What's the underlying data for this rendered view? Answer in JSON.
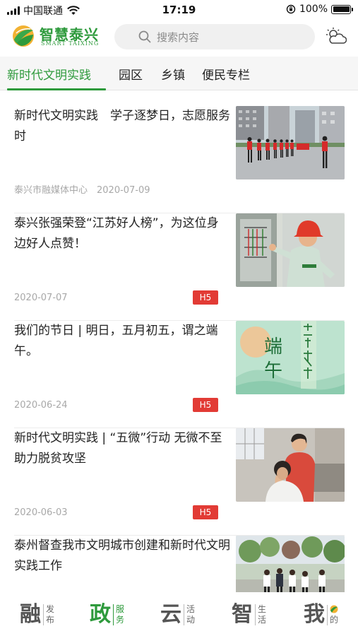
{
  "status_bar": {
    "carrier": "中国联通",
    "time": "17:19",
    "battery": "100%",
    "battery_level": 1.0
  },
  "header": {
    "logo_title": "智慧泰兴",
    "logo_subtitle": "SMART TAIXING",
    "search_placeholder": "搜索内容",
    "weather_icon": "cloud-sun-icon"
  },
  "tabs": [
    {
      "label": "新时代文明实践",
      "active": true
    },
    {
      "label": "园区",
      "active": false
    },
    {
      "label": "乡镇",
      "active": false
    },
    {
      "label": "便民专栏",
      "active": false
    }
  ],
  "news": [
    {
      "title": "新时代文明实践　学子逐梦日，志愿服务时",
      "meta": "泰兴市融媒体中心　2020-07-09",
      "badge": ""
    },
    {
      "title": "泰兴张强荣登“江苏好人榜”，为这位身边好人点赞！",
      "meta": "2020-07-07",
      "badge": "H5"
    },
    {
      "title": "我们的节日 | 明日，五月初五，谓之端午。",
      "meta": "2020-06-24",
      "badge": "H5"
    },
    {
      "title": "新时代文明实践 | “五微”行动 无微不至助力脱贫攻坚",
      "meta": "2020-06-03",
      "badge": "H5"
    },
    {
      "title": "泰州督查我市文明城市创建和新时代文明实践工作",
      "meta": "",
      "badge": ""
    }
  ],
  "thumb_text": {
    "duanwu": "端午"
  },
  "bottom_nav": [
    {
      "big": "融",
      "small": "发布",
      "active": false
    },
    {
      "big": "政",
      "small": "服务",
      "active": true
    },
    {
      "big": "云",
      "small": "活动",
      "active": false
    },
    {
      "big": "智",
      "small": "生活",
      "active": false
    },
    {
      "big": "我",
      "small": "的",
      "active": false
    }
  ],
  "colors": {
    "brand_green": "#2e9a3c",
    "badge_red": "#e23b35"
  }
}
